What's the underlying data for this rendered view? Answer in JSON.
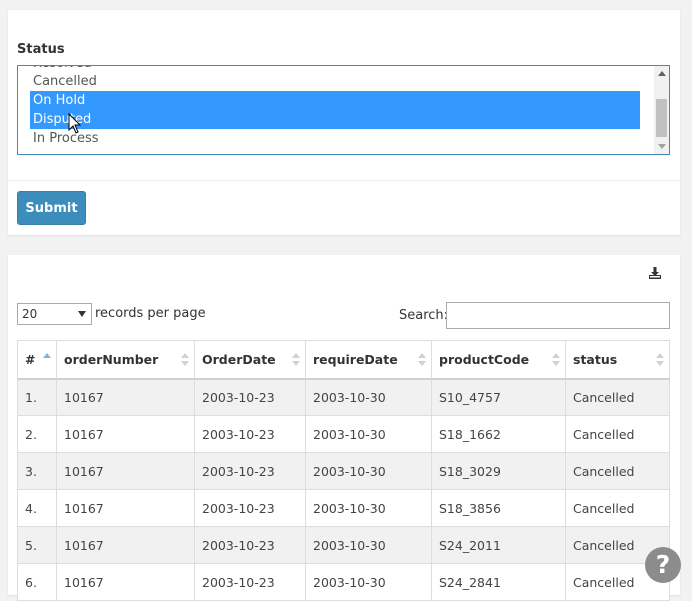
{
  "form": {
    "status_label": "Status",
    "status_options": [
      {
        "label": "Cancelled",
        "selected": false
      },
      {
        "label": "On Hold",
        "selected": true
      },
      {
        "label": "Disputed",
        "selected": true
      },
      {
        "label": "In Process",
        "selected": false
      },
      {
        "label": "",
        "selected": false
      }
    ],
    "submit_label": "Submit",
    "selection_color": "#3399ff"
  },
  "table_panel": {
    "download_icon": "download-icon",
    "page_length_value": "20",
    "records_per_page_label": "records per page",
    "search_label": "Search:",
    "search_value": "",
    "columns": [
      "#",
      "orderNumber",
      "OrderDate",
      "requireDate",
      "productCode",
      "status"
    ],
    "rows": [
      [
        "1.",
        "10167",
        "2003-10-23",
        "2003-10-30",
        "S10_4757",
        "Cancelled"
      ],
      [
        "2.",
        "10167",
        "2003-10-23",
        "2003-10-30",
        "S18_1662",
        "Cancelled"
      ],
      [
        "3.",
        "10167",
        "2003-10-23",
        "2003-10-30",
        "S18_3029",
        "Cancelled"
      ],
      [
        "4.",
        "10167",
        "2003-10-23",
        "2003-10-30",
        "S18_3856",
        "Cancelled"
      ],
      [
        "5.",
        "10167",
        "2003-10-23",
        "2003-10-30",
        "S24_2011",
        "Cancelled"
      ],
      [
        "6.",
        "10167",
        "2003-10-23",
        "2003-10-30",
        "S24_2841",
        "Cancelled"
      ]
    ]
  },
  "help": {
    "label": "?"
  },
  "colors": {
    "primary": "#3c8dbc"
  }
}
